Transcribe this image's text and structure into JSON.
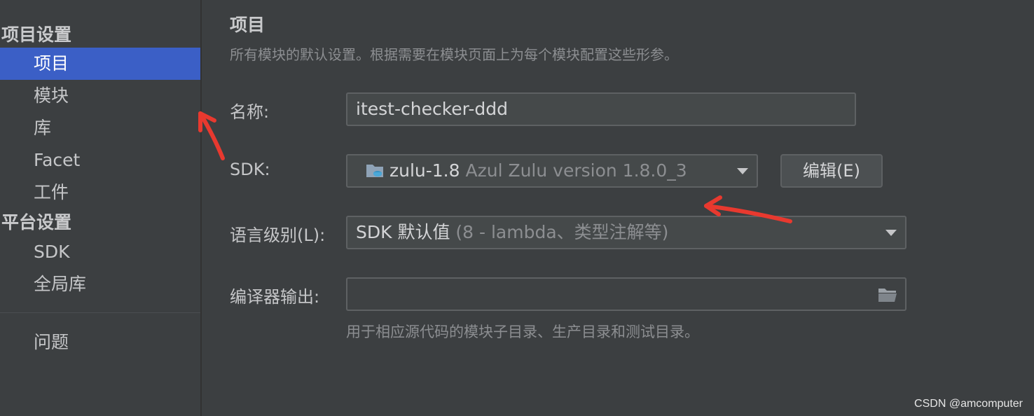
{
  "sidebar": {
    "project_settings_title": "项目设置",
    "project_items": [
      {
        "label": "项目",
        "selected": true
      },
      {
        "label": "模块",
        "selected": false
      },
      {
        "label": "库",
        "selected": false
      },
      {
        "label": "Facet",
        "selected": false
      },
      {
        "label": "工件",
        "selected": false
      }
    ],
    "platform_settings_title": "平台设置",
    "platform_items": [
      {
        "label": "SDK"
      },
      {
        "label": "全局库"
      }
    ],
    "problems_label": "问题"
  },
  "main": {
    "title": "项目",
    "description": "所有模块的默认设置。根据需要在模块页面上为每个模块配置这些形参。",
    "name_label": "名称:",
    "name_value": "itest-checker-ddd",
    "sdk_label": "SDK:",
    "sdk_name": "zulu-1.8",
    "sdk_detail": " Azul Zulu version 1.8.0_3",
    "edit_button_label": "编辑(E)",
    "language_level_label": "语言级别(L):",
    "language_level_value": "SDK 默认值",
    "language_level_detail": " (8 - lambda、类型注解等)",
    "compiler_output_label": "编译器输出:",
    "compiler_output_value": "",
    "compiler_output_hint": "用于相应源代码的模块子目录、生产目录和测试目录。"
  },
  "watermark": "CSDN @amcomputer",
  "colors": {
    "selection": "#3b5fc6",
    "annotation_arrow": "#e8392f",
    "background": "#3c3f41"
  },
  "icons": [
    "sdk-folder-icon",
    "dropdown-caret-icon",
    "browse-folder-icon",
    "annotation-arrow-icon"
  ]
}
